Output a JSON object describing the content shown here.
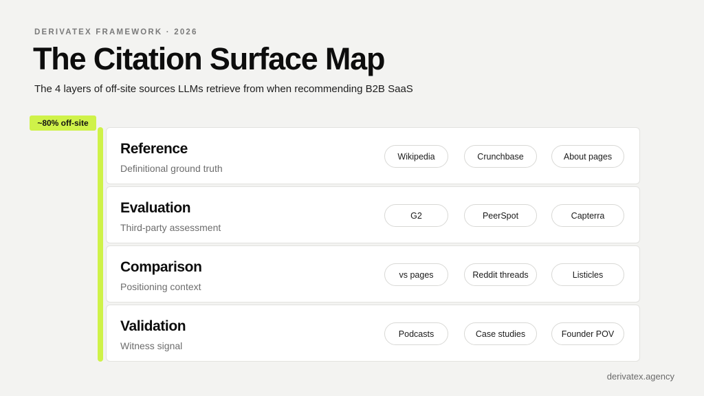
{
  "header": {
    "eyebrow": "DERIVATEX FRAMEWORK · 2026",
    "title": "The Citation Surface Map",
    "subtitle": "The 4 layers of off-site sources LLMs retrieve from when recommending B2B SaaS"
  },
  "badge": {
    "label": "~80% off-site"
  },
  "layers": [
    {
      "name": "Reference",
      "description": "Definitional ground truth",
      "sources": [
        "Wikipedia",
        "Crunchbase",
        "About pages"
      ]
    },
    {
      "name": "Evaluation",
      "description": "Third-party assessment",
      "sources": [
        "G2",
        "PeerSpot",
        "Capterra"
      ]
    },
    {
      "name": "Comparison",
      "description": "Positioning context",
      "sources": [
        "vs pages",
        "Reddit threads",
        "Listicles"
      ]
    },
    {
      "name": "Validation",
      "description": "Witness signal",
      "sources": [
        "Podcasts",
        "Case studies",
        "Founder POV"
      ]
    }
  ],
  "footer": {
    "site": "derivatex.agency"
  },
  "colors": {
    "accent": "#cff249",
    "background": "#f3f3f1",
    "card": "#ffffff"
  }
}
